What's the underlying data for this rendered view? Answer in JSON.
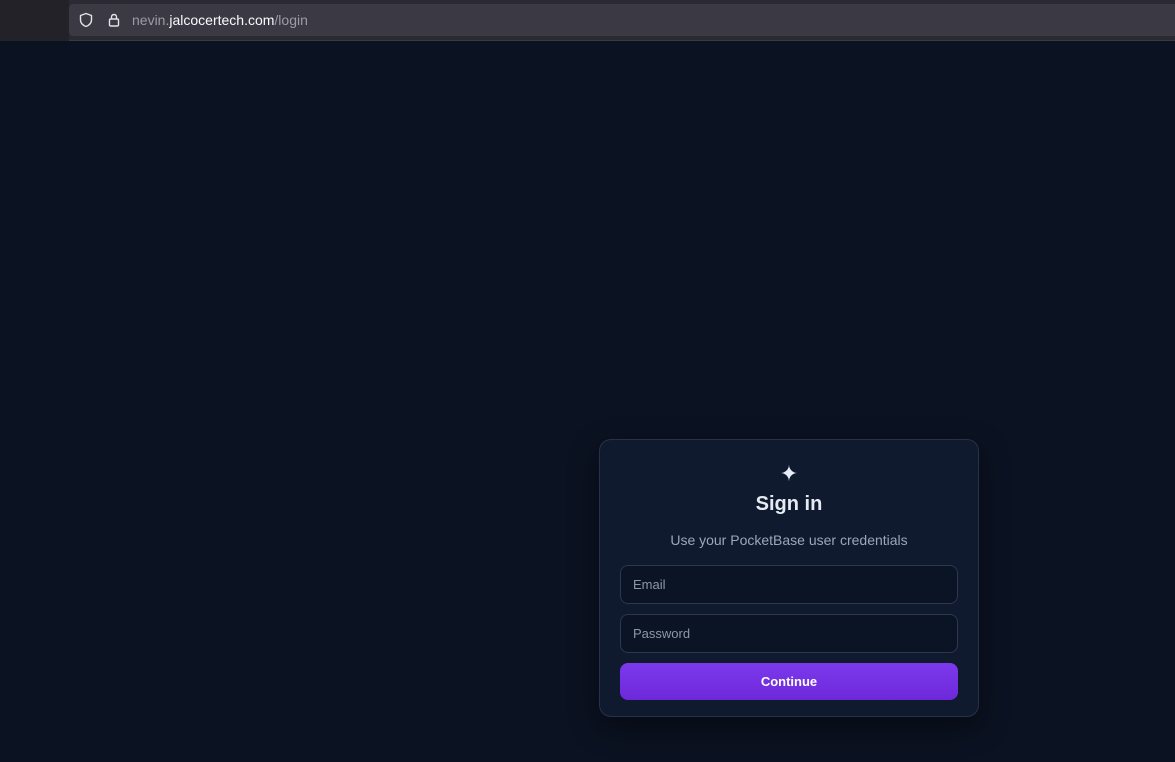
{
  "browser": {
    "url_subdomain": "nevin.",
    "url_host": "jalcocertech.com",
    "url_path": "/login",
    "icons": {
      "shield": "shield-icon",
      "lock": "lock-icon"
    }
  },
  "login": {
    "logo_glyph": "✦",
    "title": "Sign in",
    "subtitle": "Use your PocketBase user credentials",
    "email_placeholder": "Email",
    "email_value": "",
    "password_placeholder": "Password",
    "password_value": "",
    "continue_label": "Continue"
  },
  "colors": {
    "background": "#0b1221",
    "card": "#0f1a2e",
    "accent": "#7c3aed"
  }
}
